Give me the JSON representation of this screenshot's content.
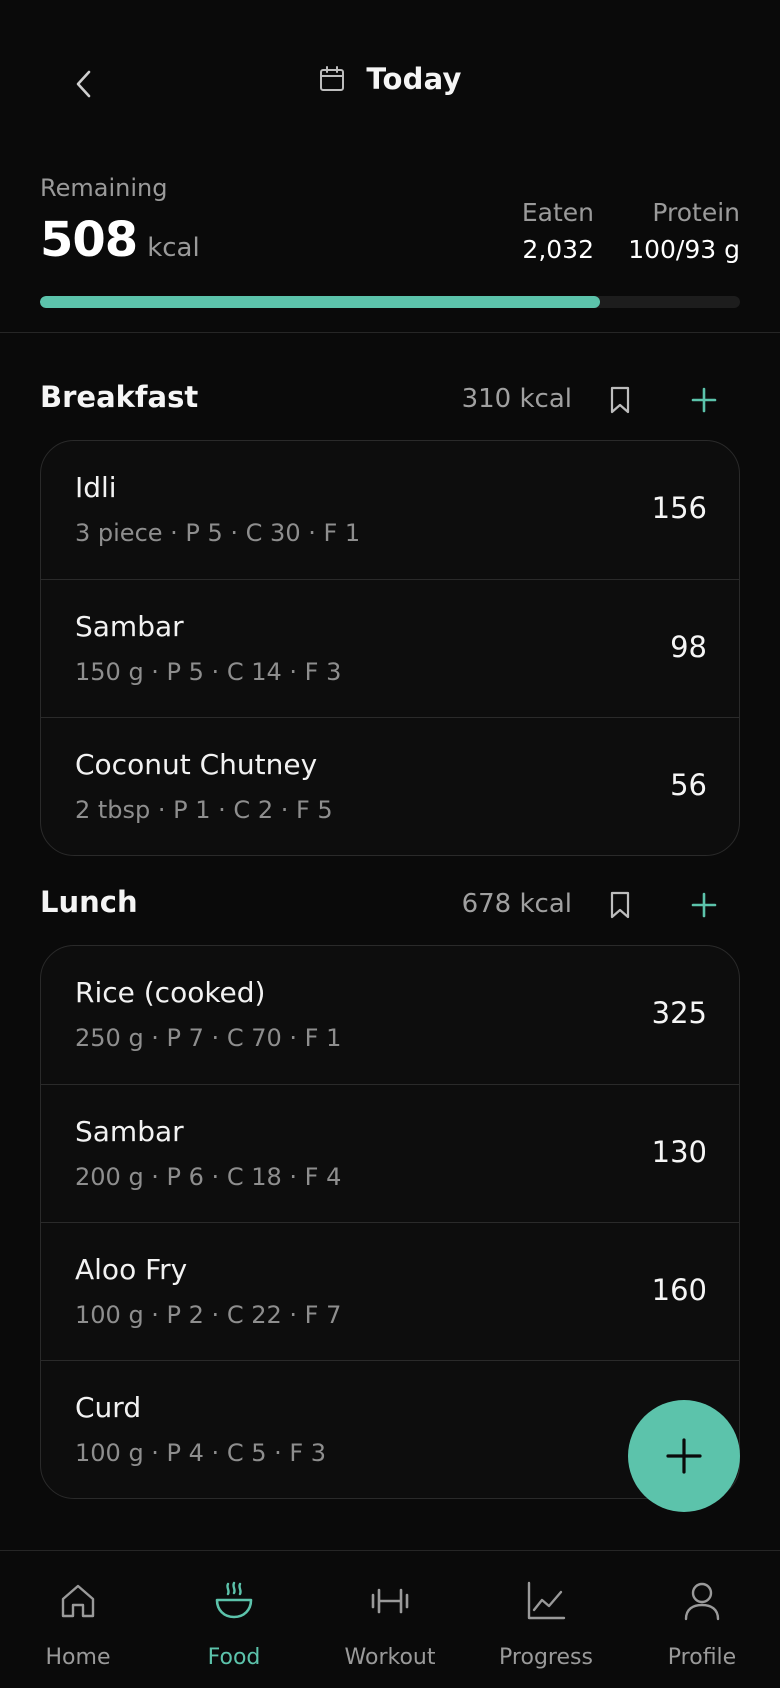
{
  "header": {
    "title": "Today",
    "back_icon": "chevron-left-icon",
    "calendar_icon": "calendar-icon"
  },
  "summary": {
    "remaining_label": "Remaining",
    "remaining_value": "508",
    "remaining_unit": "kcal",
    "eaten_label": "Eaten",
    "eaten_value": "2,032",
    "protein_label": "Protein",
    "protein_value": "100/93 g",
    "progress_fraction": 0.8
  },
  "meals": [
    {
      "name": "Breakfast",
      "kcal": "310 kcal",
      "items": [
        {
          "name": "Idli",
          "detail": "3 piece · P 5 · C 30 · F 1",
          "kcal": "156"
        },
        {
          "name": "Sambar",
          "detail": "150 g · P 5 · C 14 · F 3",
          "kcal": "98"
        },
        {
          "name": "Coconut Chutney",
          "detail": "2 tbsp · P 1 · C 2 · F 5",
          "kcal": "56"
        }
      ]
    },
    {
      "name": "Lunch",
      "kcal": "678 kcal",
      "items": [
        {
          "name": "Rice (cooked)",
          "detail": "250 g · P 7 · C 70 · F 1",
          "kcal": "325"
        },
        {
          "name": "Sambar",
          "detail": "200 g · P 6 · C 18 · F 4",
          "kcal": "130"
        },
        {
          "name": "Aloo Fry",
          "detail": "100 g · P 2 · C 22 · F 7",
          "kcal": "160"
        },
        {
          "name": "Curd",
          "detail": "100 g · P 4 · C 5 · F 3",
          "kcal": ""
        }
      ]
    }
  ],
  "nav": {
    "items": [
      {
        "label": "Home",
        "icon": "home-icon",
        "active": false
      },
      {
        "label": "Food",
        "icon": "bowl-icon",
        "active": true
      },
      {
        "label": "Workout",
        "icon": "dumbbell-icon",
        "active": false
      },
      {
        "label": "Progress",
        "icon": "chart-icon",
        "active": false
      },
      {
        "label": "Profile",
        "icon": "user-icon",
        "active": false
      }
    ]
  },
  "colors": {
    "accent": "#5cc3ab",
    "background": "#0a0a0a",
    "muted_text": "#9a9a9a"
  }
}
